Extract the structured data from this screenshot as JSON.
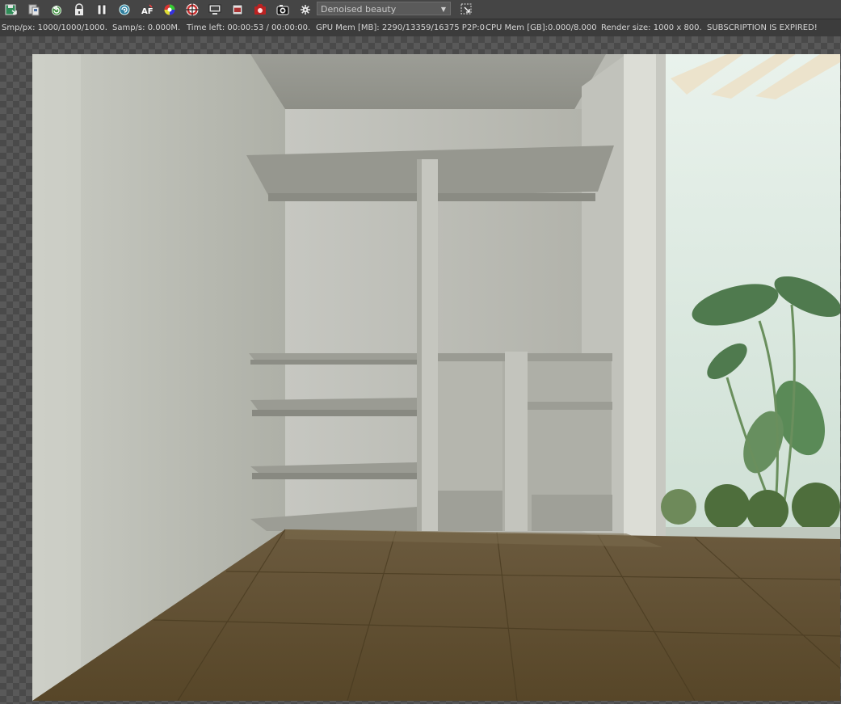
{
  "toolbar": {
    "buttons": [
      "save-image-icon",
      "copy-image-icon",
      "restart-render-icon",
      "lock-icon",
      "pause-icon",
      "refresh-scene-icon",
      "af-focus-icon",
      "color-picker-icon",
      "target-icon",
      "monitor-icon",
      "render-region-icon",
      "material-preview-icon",
      "camera-icon",
      "settings-gear-icon"
    ],
    "pass_select": {
      "selected": "Denoised beauty"
    },
    "region_button": "region-select-icon"
  },
  "status": {
    "samples_per_px": "Smp/px: 1000/1000/1000.",
    "samples_per_sec": "Samp/s: 0.000M.",
    "time_left": "Time left: 00:00:53 / 00:00:00.",
    "gpu_mem": "GPU Mem [MB]: 2290/13359/16375 P2P:0",
    "cpu_mem": "CPU Mem [GB]:0.000/8.000",
    "render_size": "Render size: 1000 x 800.",
    "subscription": "SUBSCRIPTION IS EXPIRED!"
  },
  "render": {
    "description_icon": "rendered-image"
  }
}
